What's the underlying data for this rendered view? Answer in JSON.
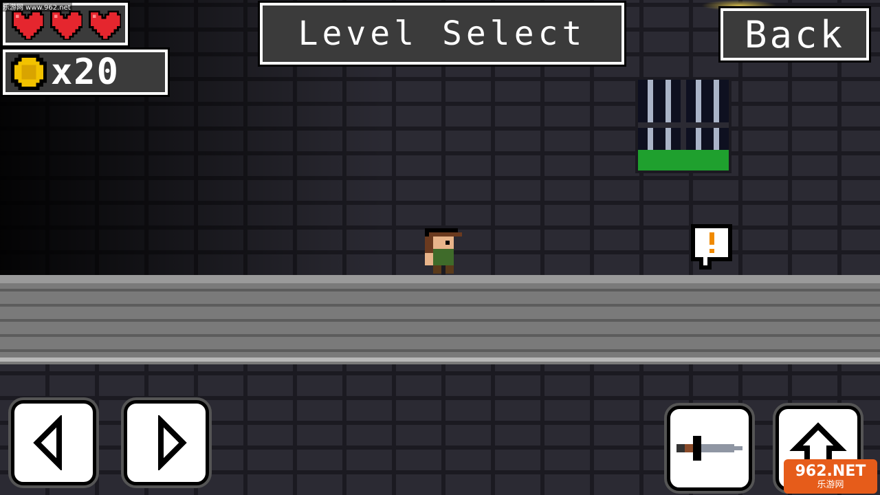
{
  "hud": {
    "lives": 3,
    "coin_count": "x20",
    "title": "Level Select",
    "back_label": "Back"
  },
  "controls": {
    "left": "move-left",
    "right": "move-right",
    "attack": "attack",
    "jump": "jump"
  },
  "npc_bubble": "!",
  "watermark": {
    "top": "乐游网 www.962.net",
    "logo": "962.NET",
    "logo_sub": "乐游网"
  },
  "colors": {
    "heart": "#e5262e",
    "coin": "#f2c200",
    "panel": "#3b3b3b",
    "slime": "#1fa02e"
  }
}
